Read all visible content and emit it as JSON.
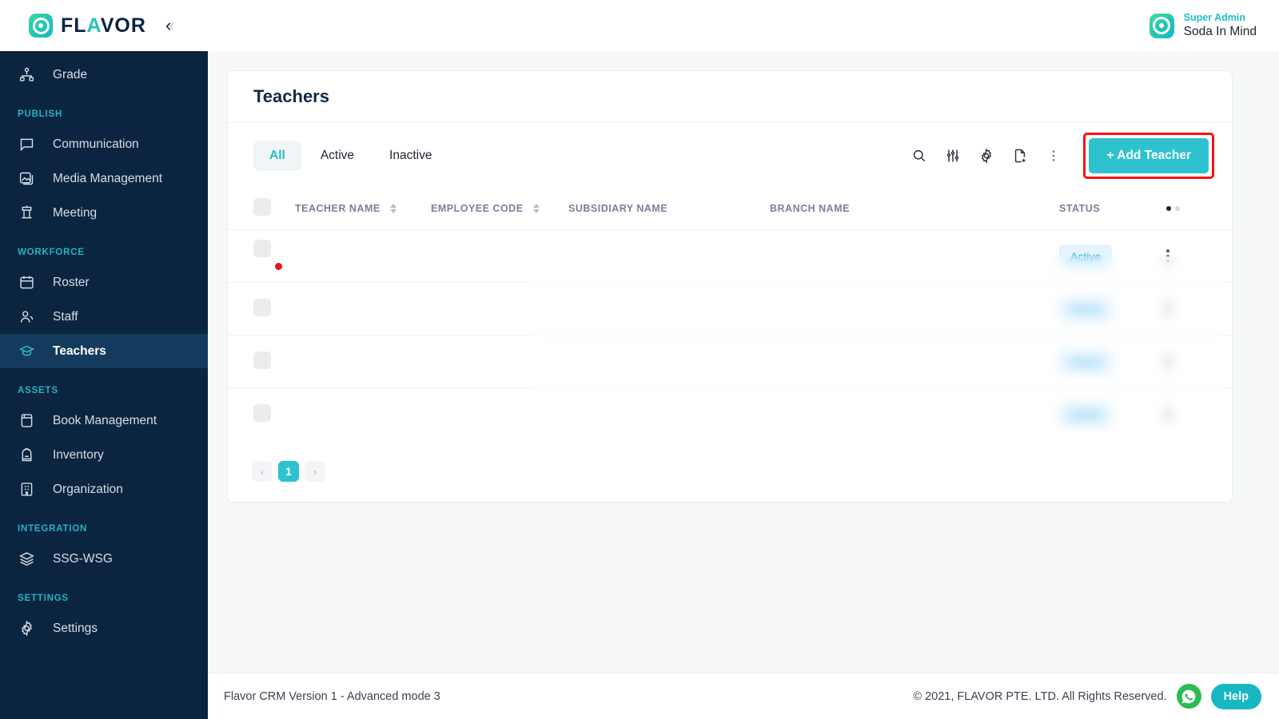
{
  "brand": {
    "name_plain": "FL",
    "name_accent": "A",
    "name_rest": "VOR",
    "full": "FLAVOR"
  },
  "topbar": {
    "role": "Super Admin",
    "account": "Soda In Mind"
  },
  "sidebar": {
    "items": [
      {
        "label": "Grade",
        "icon": "hierarchy-icon",
        "active": false
      },
      {
        "section": "PUBLISH"
      },
      {
        "label": "Communication",
        "icon": "chat-icon",
        "active": false
      },
      {
        "label": "Media Management",
        "icon": "image-icon",
        "active": false
      },
      {
        "label": "Meeting",
        "icon": "podium-icon",
        "active": false
      },
      {
        "section": "WORKFORCE"
      },
      {
        "label": "Roster",
        "icon": "calendar-icon",
        "active": false
      },
      {
        "label": "Staff",
        "icon": "user-icon",
        "active": false
      },
      {
        "label": "Teachers",
        "icon": "graduation-cap-icon",
        "active": true
      },
      {
        "section": "ASSETS"
      },
      {
        "label": "Book Management",
        "icon": "book-icon",
        "active": false
      },
      {
        "label": "Inventory",
        "icon": "backpack-icon",
        "active": false
      },
      {
        "label": "Organization",
        "icon": "building-icon",
        "active": false
      },
      {
        "section": "INTEGRATION"
      },
      {
        "label": "SSG-WSG",
        "icon": "layers-icon",
        "active": false
      },
      {
        "section": "SETTINGS"
      },
      {
        "label": "Settings",
        "icon": "gear-icon",
        "active": false
      }
    ]
  },
  "page": {
    "title": "Teachers",
    "tabs": [
      {
        "label": "All",
        "active": true
      },
      {
        "label": "Active",
        "active": false
      },
      {
        "label": "Inactive",
        "active": false
      }
    ],
    "toolbar_icons": [
      "search-icon",
      "filter-sliders-icon",
      "gear-icon",
      "document-add-icon",
      "more-vertical-icon"
    ],
    "add_button": "+ Add Teacher",
    "add_button_highlight_color": "#fb1111",
    "accent_color": "#2ec2cf"
  },
  "table": {
    "columns": [
      {
        "key": "checkbox",
        "label": "",
        "sortable": false
      },
      {
        "key": "teacher_name",
        "label": "TEACHER NAME",
        "sortable": true
      },
      {
        "key": "employee_code",
        "label": "EMPLOYEE CODE",
        "sortable": true
      },
      {
        "key": "subsidiary_name",
        "label": "SUBSIDIARY NAME",
        "sortable": false
      },
      {
        "key": "branch_name",
        "label": "BRANCH NAME",
        "sortable": false
      },
      {
        "key": "status",
        "label": "STATUS",
        "sortable": false
      },
      {
        "key": "actions",
        "label": "",
        "sortable": false
      }
    ],
    "header_dots": {
      "active": 1,
      "total": 2
    },
    "rows": [
      {
        "flag": true,
        "teacher_name": "",
        "employee_code": "",
        "subsidiary_name": "",
        "branch_name": "",
        "status": "Active",
        "redacted": true
      },
      {
        "flag": false,
        "teacher_name": "",
        "employee_code": "",
        "subsidiary_name": "",
        "branch_name": "",
        "status": "Active",
        "redacted": true
      },
      {
        "flag": false,
        "teacher_name": "",
        "employee_code": "",
        "subsidiary_name": "",
        "branch_name": "",
        "status": "Active",
        "redacted": true
      },
      {
        "flag": false,
        "teacher_name": "",
        "employee_code": "",
        "subsidiary_name": "",
        "branch_name": "",
        "status": "Active",
        "redacted": true
      }
    ],
    "status_badge_bg": "#e3f4fd",
    "status_badge_fg": "#2fabe2"
  },
  "pagination": {
    "prev": "‹",
    "next": "›",
    "pages": [
      "1"
    ],
    "current": "1"
  },
  "footer": {
    "version": "Flavor CRM Version 1 - Advanced mode 3",
    "copyright": "© 2021, FLAVOR PTE. LTD. All Rights Reserved.",
    "help_label": "Help",
    "whatsapp_icon": "whatsapp-icon"
  }
}
